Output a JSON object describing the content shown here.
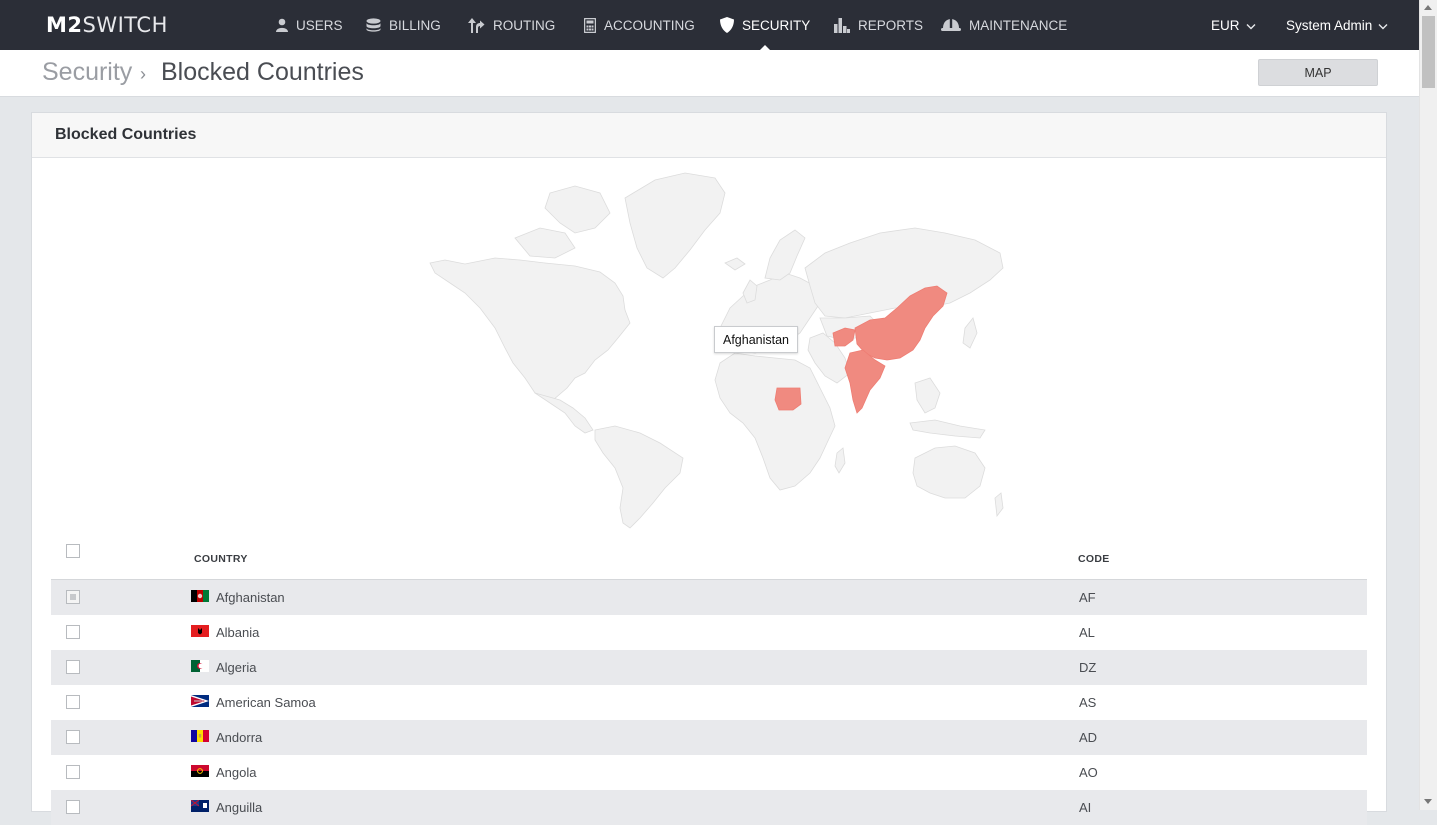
{
  "app": {
    "logo_bold": "M2",
    "logo_light": "SWITCH"
  },
  "nav": [
    {
      "label": "USERS",
      "icon": "user-icon"
    },
    {
      "label": "BILLING",
      "icon": "database-icon"
    },
    {
      "label": "ROUTING",
      "icon": "routing-arrows-icon"
    },
    {
      "label": "ACCOUNTING",
      "icon": "calculator-icon"
    },
    {
      "label": "SECURITY",
      "icon": "shield-icon",
      "active": true
    },
    {
      "label": "REPORTS",
      "icon": "bar-chart-icon"
    },
    {
      "label": "MAINTENANCE",
      "icon": "hard-hat-icon"
    }
  ],
  "currency": "EUR",
  "user_menu": "System Admin",
  "breadcrumb": {
    "root": "Security",
    "separator": "›",
    "current": "Blocked Countries"
  },
  "map_button": "MAP",
  "panel": {
    "title": "Blocked Countries"
  },
  "map": {
    "tooltip": "Afghanistan",
    "highlight_color": "#f08a80",
    "base_color": "#f2f2f2",
    "highlighted_countries": [
      "Afghanistan",
      "China",
      "India",
      "Sudan"
    ]
  },
  "table": {
    "headers": {
      "country": "COUNTRY",
      "code": "CODE"
    },
    "rows": [
      {
        "country": "Afghanistan",
        "code": "AF",
        "checked": true
      },
      {
        "country": "Albania",
        "code": "AL",
        "checked": false
      },
      {
        "country": "Algeria",
        "code": "DZ",
        "checked": false
      },
      {
        "country": "American Samoa",
        "code": "AS",
        "checked": false
      },
      {
        "country": "Andorra",
        "code": "AD",
        "checked": false
      },
      {
        "country": "Angola",
        "code": "AO",
        "checked": false
      },
      {
        "country": "Anguilla",
        "code": "AI",
        "checked": false
      }
    ]
  }
}
